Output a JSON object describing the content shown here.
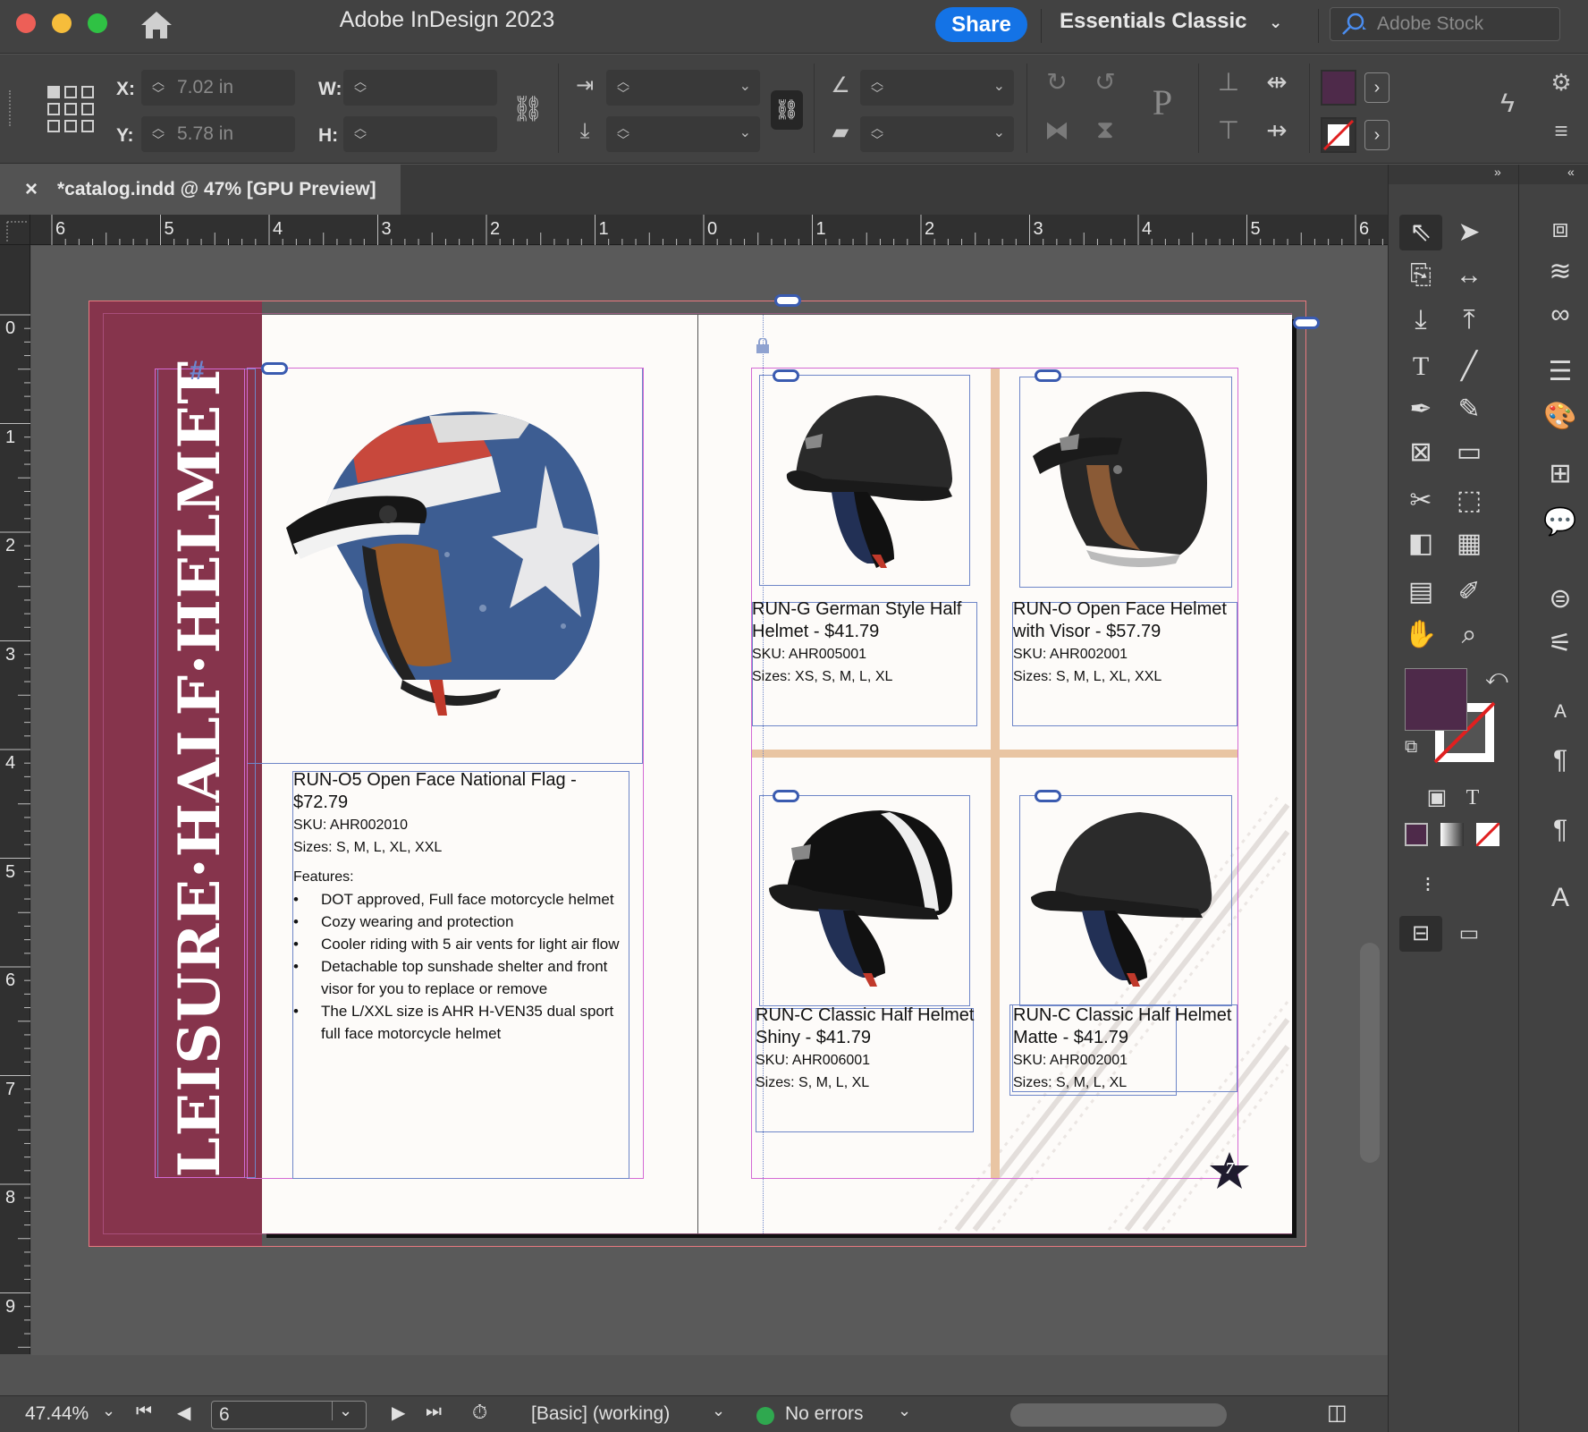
{
  "app": {
    "title": "Adobe InDesign 2023",
    "share_label": "Share",
    "workspace_label": "Essentials Classic",
    "stock_placeholder": "Adobe Stock"
  },
  "control": {
    "x_label": "X:",
    "x_value": "7.02 in",
    "y_label": "Y:",
    "y_value": "5.78 in",
    "w_label": "W:",
    "h_label": "H:",
    "fill_color": "#4e2a4a"
  },
  "tab": {
    "close": "×",
    "title": "*catalog.indd @ 47% [GPU Preview]"
  },
  "rulers": {
    "h": [
      "6",
      "5",
      "4",
      "3",
      "2",
      "1",
      "0",
      "1",
      "2",
      "3",
      "4",
      "5",
      "6"
    ],
    "v": [
      "0",
      "1",
      "2",
      "3",
      "4",
      "5",
      "6",
      "7",
      "8",
      "9"
    ]
  },
  "spread": {
    "banner_title": "LEISURE·HALF·HELMET",
    "banner_color": "#86344c",
    "page_number": "7",
    "featured": {
      "name": "RUN-O5 Open Face National Flag - $72.79",
      "sku": "SKU: AHR002010",
      "sizes": "Sizes: S, M, L, XL, XXL",
      "features_heading": "Features:",
      "features": [
        "DOT approved, Full face motorcycle helmet",
        "Cozy wearing and protection",
        "Cooler riding with 5 air vents for light air flow",
        "Detachable top sunshade shelter and front visor for you to replace or remove",
        "The L/XXL size is AHR H-VEN35 dual sport full face motorcycle helmet"
      ]
    },
    "products": [
      {
        "name1": "RUN-G German Style Half",
        "name2": "Helmet - $41.79",
        "sku": "SKU: AHR005001",
        "sizes": "Sizes: XS, S, M, L, XL"
      },
      {
        "name1": "RUN-O Open Face Helmet",
        "name2": "with Visor - $57.79",
        "sku": "SKU: AHR002001",
        "sizes": "Sizes: S, M, L, XL, XXL"
      },
      {
        "name1": "RUN-C Classic Half Helmet",
        "name2": "Shiny - $41.79",
        "sku": "SKU: AHR006001",
        "sizes": "Sizes: S, M, L, XL"
      },
      {
        "name1": "RUN-C Classic Half Helmet",
        "name2": "Matte - $41.79",
        "sku": "SKU: AHR002001",
        "sizes": "Sizes: S, M, L, XL"
      }
    ]
  },
  "status": {
    "zoom": "47.44%",
    "page": "6",
    "style": "[Basic] (working)",
    "errors": "No errors",
    "ok_color": "#2fa84f"
  },
  "colors": {
    "fill_swatch": "#4e2a4a",
    "accent_blue": "#1473e6"
  }
}
